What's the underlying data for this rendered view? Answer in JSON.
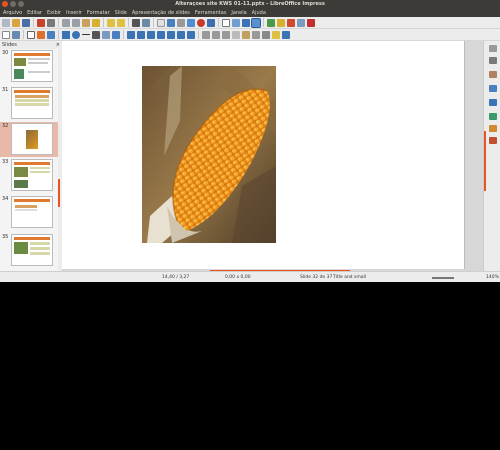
{
  "window": {
    "title": "Alteraçoes site KWS 01-11.pptx - LibreOffice Impress"
  },
  "menubar": {
    "items": [
      "Arquivo",
      "Editar",
      "Exibir",
      "Inserir",
      "Formatar",
      "Slide",
      "Apresentação de slides",
      "Ferramentas",
      "Janela",
      "Ajuda"
    ]
  },
  "slides_panel": {
    "title": "Slides",
    "close_label": "×",
    "thumbs": [
      {
        "num": "30",
        "selected": false
      },
      {
        "num": "31",
        "selected": false
      },
      {
        "num": "32",
        "selected": true
      },
      {
        "num": "33",
        "selected": false
      },
      {
        "num": "34",
        "selected": false
      },
      {
        "num": "35",
        "selected": false
      }
    ]
  },
  "colors": {
    "accent": "#e95420",
    "titlebar": "#3c3b37",
    "thumb_header": "#e07a2e",
    "thumb_table": "#d7d7a8"
  },
  "statusbar": {
    "position": "14,40 / 3,27",
    "size": "0,00 x 0,00",
    "slide_info": "Slide 32 de 37",
    "master": "Title and small",
    "zoom": "140%"
  }
}
